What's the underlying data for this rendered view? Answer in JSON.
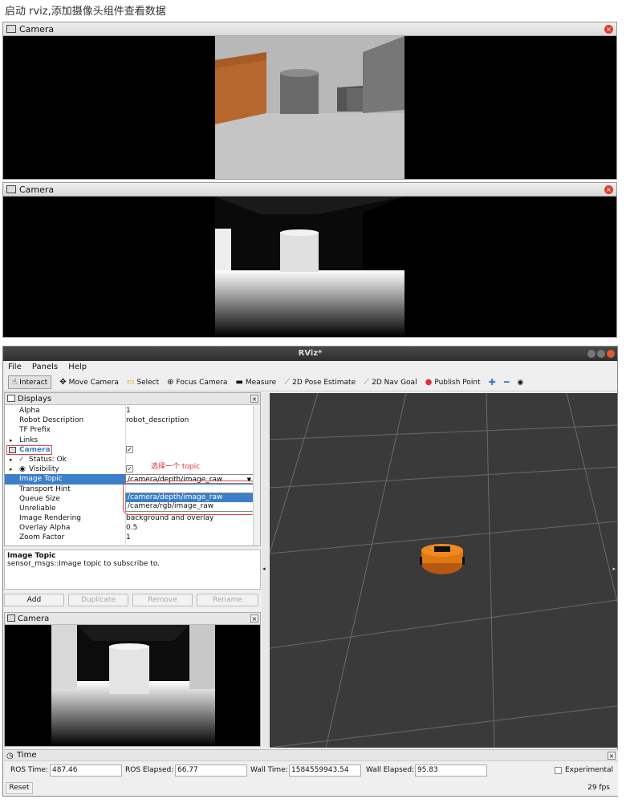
{
  "caption": "启动 rviz,添加摄像头组件查看数据",
  "camera_windows": [
    {
      "title": "Camera"
    },
    {
      "title": "Camera"
    }
  ],
  "rviz": {
    "window_title": "RViz*",
    "menu": [
      "File",
      "Panels",
      "Help"
    ],
    "toolbar": [
      {
        "label": "Interact",
        "icon": "hand-icon",
        "active": true
      },
      {
        "label": "Move Camera",
        "icon": "move-camera-icon"
      },
      {
        "label": "Select",
        "icon": "select-icon"
      },
      {
        "label": "Focus Camera",
        "icon": "focus-camera-icon"
      },
      {
        "label": "Measure",
        "icon": "ruler-icon"
      },
      {
        "label": "2D Pose Estimate",
        "icon": "green-arrow-icon"
      },
      {
        "label": "2D Nav Goal",
        "icon": "green-arrow-icon"
      },
      {
        "label": "Publish Point",
        "icon": "pin-icon"
      }
    ],
    "displays": {
      "title": "Displays",
      "rows": [
        {
          "key": "Alpha",
          "value": "1"
        },
        {
          "key": "Robot Description",
          "value": "robot_description"
        },
        {
          "key": "TF Prefix",
          "value": ""
        },
        {
          "key": "Links",
          "value": ""
        },
        {
          "key": "Camera",
          "value": "✓"
        },
        {
          "key": "Status: Ok",
          "value": ""
        },
        {
          "key": "Visibility",
          "value": "✓"
        },
        {
          "key": "Image Topic",
          "value": "/camera/depth/image_raw"
        },
        {
          "key": "Transport Hint",
          "value": ""
        },
        {
          "key": "Queue Size",
          "value": ""
        },
        {
          "key": "Unreliable",
          "value": ""
        },
        {
          "key": "Image Rendering",
          "value": "background and overlay"
        },
        {
          "key": "Overlay Alpha",
          "value": "0.5"
        },
        {
          "key": "Zoom Factor",
          "value": "1"
        }
      ],
      "annotation": "选择一个 topic",
      "dropdown_options": [
        "/camera/depth/image_raw",
        "/camera/rgb/image_raw"
      ]
    },
    "description": {
      "title": "Image Topic",
      "text": "sensor_msgs::Image topic to subscribe to."
    },
    "buttons": {
      "add": "Add",
      "duplicate": "Duplicate",
      "remove": "Remove",
      "rename": "Rename"
    },
    "camera_panel_title": "Camera",
    "time": {
      "title": "Time",
      "ros_time_label": "ROS Time:",
      "ros_time": "487.46",
      "ros_elapsed_label": "ROS Elapsed:",
      "ros_elapsed": "66.77",
      "wall_time_label": "Wall Time:",
      "wall_time": "1584559943.54",
      "wall_elapsed_label": "Wall Elapsed:",
      "wall_elapsed": "95.83",
      "experimental": "Experimental",
      "reset": "Reset",
      "fps": "29 fps"
    }
  }
}
